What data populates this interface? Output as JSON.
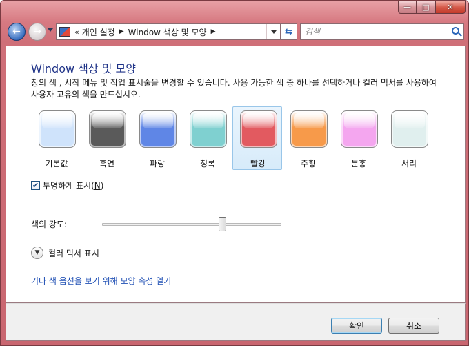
{
  "window": {
    "minimize_glyph": "—",
    "maximize_glyph": "□",
    "close_glyph": "✕"
  },
  "nav": {
    "breadcrumb_overflow": "«",
    "breadcrumb": [
      "개인 설정",
      "Window 색상 및 모양"
    ],
    "search_placeholder": "검색"
  },
  "main": {
    "title": "Window 색상 및 모양",
    "description": "창의 색 , 시작 메뉴 및 작업 표시줄을 변경할 수 있습니다. 사용 가능한 색 중 하나를 선택하거나 컬러 믹서를 사용하여 사용자 고유의 색을 만드십시오.",
    "swatches": [
      {
        "label": "기본값",
        "color": "#cfe3fb",
        "selected": false
      },
      {
        "label": "흑연",
        "color": "#5a5a5a",
        "selected": false
      },
      {
        "label": "파랑",
        "color": "#5f86e6",
        "selected": false
      },
      {
        "label": "청록",
        "color": "#7fd0d0",
        "selected": false
      },
      {
        "label": "빨강",
        "color": "#e25a60",
        "selected": true
      },
      {
        "label": "주황",
        "color": "#f79a4a",
        "selected": false
      },
      {
        "label": "분홍",
        "color": "#f4a6ef",
        "selected": false
      },
      {
        "label": "서리",
        "color": "#e0efee",
        "selected": false
      }
    ],
    "transparency": {
      "label": "투명하게 표시",
      "accel": "N",
      "checked": true,
      "check_glyph": "✔"
    },
    "intensity_label": "색의 강도:",
    "intensity_value": 0.67,
    "mixer_label": "컬러 믹서 표시",
    "more_options_link": "기타 색 옵션을 보기 위해 모양 속성 열기"
  },
  "buttons": {
    "ok": "확인",
    "cancel": "취소"
  }
}
